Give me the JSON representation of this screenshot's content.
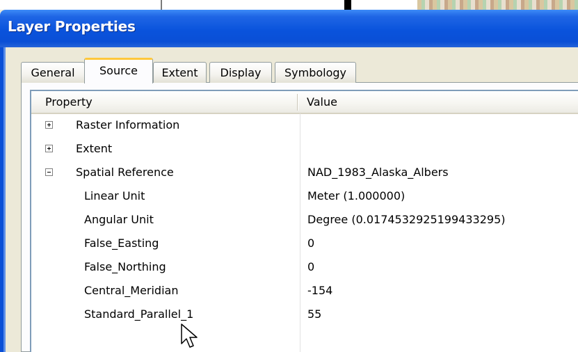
{
  "window": {
    "title": "Layer Properties"
  },
  "tabs": [
    {
      "label": "General",
      "active": false
    },
    {
      "label": "Source",
      "active": true
    },
    {
      "label": "Extent",
      "active": false
    },
    {
      "label": "Display",
      "active": false
    },
    {
      "label": "Symbology",
      "active": false
    }
  ],
  "grid": {
    "header": {
      "property": "Property",
      "value": "Value"
    },
    "rows": [
      {
        "property": "Raster Information",
        "value": "",
        "expander": "plus",
        "level": 0
      },
      {
        "property": "Extent",
        "value": "",
        "expander": "plus",
        "level": 0
      },
      {
        "property": "Spatial Reference",
        "value": "NAD_1983_Alaska_Albers",
        "expander": "minus",
        "level": 0
      },
      {
        "property": "Linear Unit",
        "value": "Meter (1.000000)",
        "expander": "none",
        "level": 1
      },
      {
        "property": "Angular Unit",
        "value": "Degree (0.0174532925199433295)",
        "expander": "none",
        "level": 1
      },
      {
        "property": "False_Easting",
        "value": "0",
        "expander": "none",
        "level": 1
      },
      {
        "property": "False_Northing",
        "value": "0",
        "expander": "none",
        "level": 1
      },
      {
        "property": "Central_Meridian",
        "value": "-154",
        "expander": "none",
        "level": 1
      },
      {
        "property": "Standard_Parallel_1",
        "value": "55",
        "expander": "none",
        "level": 1
      }
    ]
  },
  "icons": {
    "expand": "plus-box-icon",
    "collapse": "minus-box-icon",
    "cursor": "mouse-pointer-icon"
  }
}
